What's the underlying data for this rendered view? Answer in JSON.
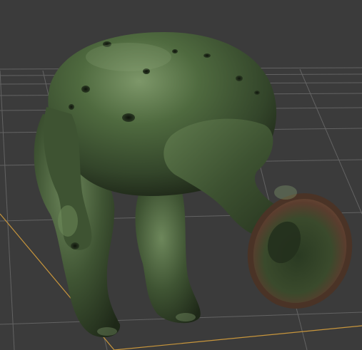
{
  "app": {
    "view": "perspective-viewport",
    "display_mode": "shaded"
  },
  "viewport": {
    "background_color": "#3b3b3b",
    "grid_line_color": "#6a6a6a",
    "grid_axis_color": "#c8963c",
    "grid_visible": true
  },
  "scene": {
    "model": {
      "name_visible": false,
      "base_color": "#3f5433",
      "highlight_color": "#7d9769",
      "shadow_color": "#1c2416",
      "mouth_inner_color": "#5a3d2e"
    }
  }
}
